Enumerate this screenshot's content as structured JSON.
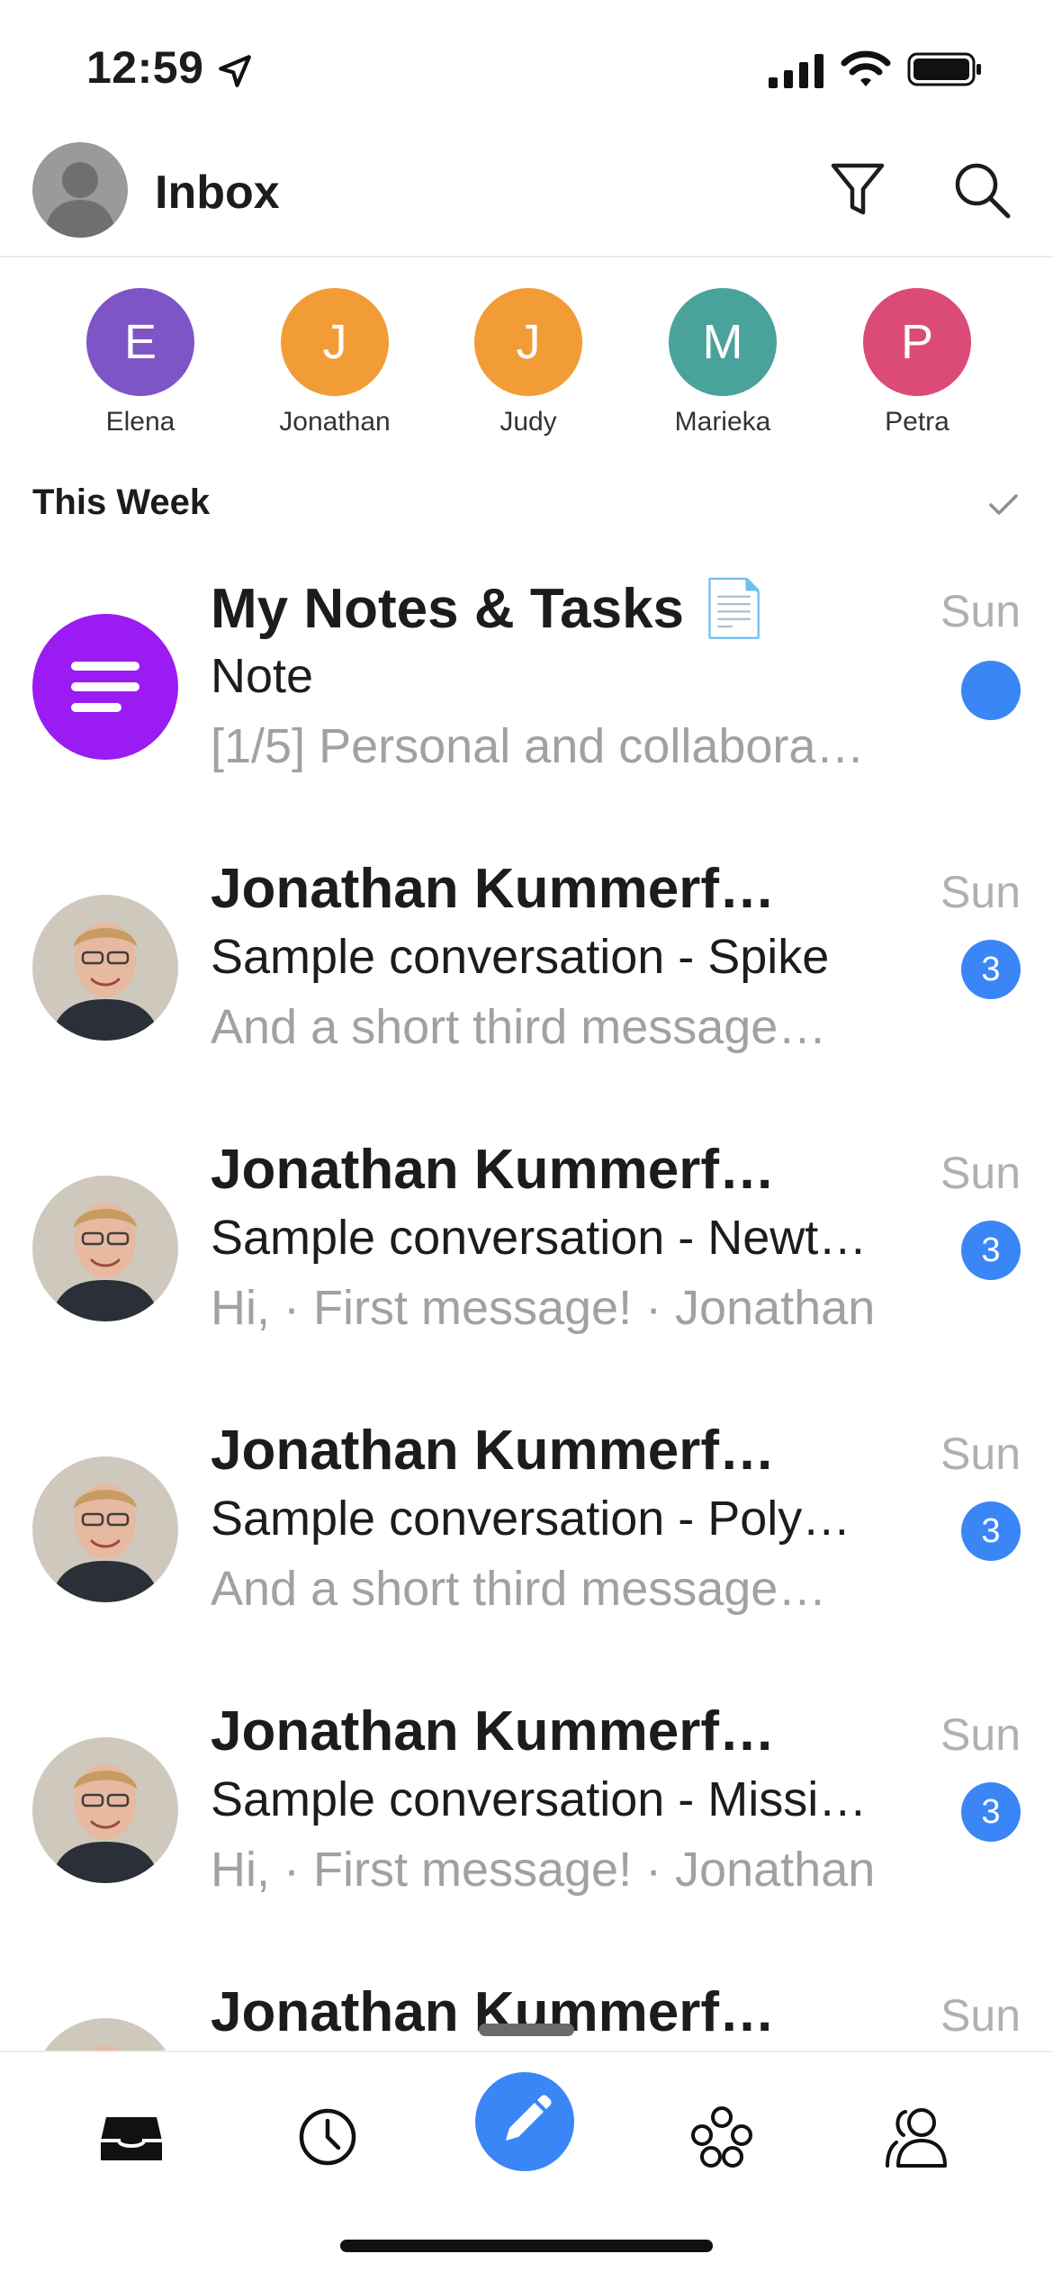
{
  "status_bar": {
    "time": "12:59"
  },
  "header": {
    "title": "Inbox"
  },
  "contacts": [
    {
      "initial": "E",
      "name": "Elena",
      "color": "#7d55c7"
    },
    {
      "initial": "J",
      "name": "Jonathan",
      "color": "#f29c38"
    },
    {
      "initial": "J",
      "name": "Judy",
      "color": "#f29c38"
    },
    {
      "initial": "M",
      "name": "Marieka",
      "color": "#4aa39b"
    },
    {
      "initial": "P",
      "name": "Petra",
      "color": "#dc4b78"
    }
  ],
  "section": {
    "title": "This Week"
  },
  "emails": [
    {
      "sender": "My Notes & Tasks 📄",
      "date": "Sun",
      "subject": "Note",
      "preview": "[1/5] Personal and collabora…",
      "badge": ""
    },
    {
      "sender": "Jonathan Kummerf…",
      "date": "Sun",
      "subject": "Sample conversation - Spike",
      "preview": "And a short third message…",
      "badge": "3"
    },
    {
      "sender": "Jonathan Kummerf…",
      "date": "Sun",
      "subject": "Sample conversation - Newt…",
      "preview": "Hi, · First message! · Jonathan",
      "badge": "3"
    },
    {
      "sender": "Jonathan Kummerf…",
      "date": "Sun",
      "subject": "Sample conversation - Poly…",
      "preview": "And a short third message…",
      "badge": "3"
    },
    {
      "sender": "Jonathan Kummerf…",
      "date": "Sun",
      "subject": "Sample conversation - Missi…",
      "preview": "Hi, · First message! · Jonathan",
      "badge": "3"
    },
    {
      "sender": "Jonathan Kummerf…",
      "date": "Sun",
      "subject": "",
      "preview": "",
      "badge": ""
    }
  ],
  "colors": {
    "accent": "#3a86f7",
    "notes": "#9a1cf2"
  },
  "tabs": [
    "inbox-icon",
    "clock-icon",
    "compose-icon",
    "groups-icon",
    "contacts-icon"
  ]
}
